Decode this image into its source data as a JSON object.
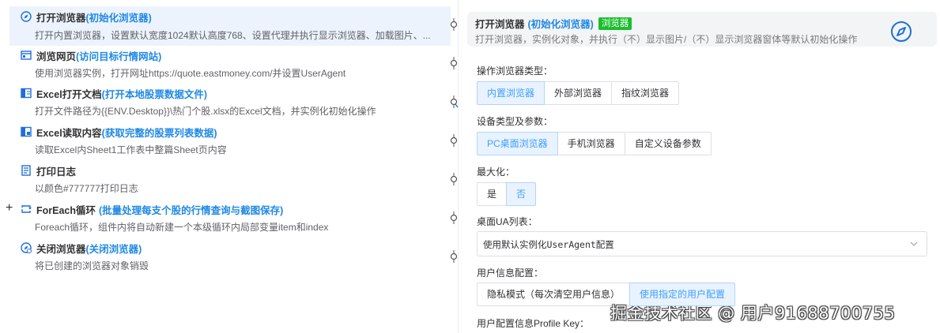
{
  "steps": [
    {
      "title": "打开浏览器",
      "note": "(初始化浏览器)",
      "desc": "打开内置浏览器，设置默认宽度1024默认高度768、设置代理并执行显示浏览器、加载图片、...",
      "icon": "compass-icon"
    },
    {
      "title": "浏览网页",
      "note": "(访问目标行情网站)",
      "desc": "使用浏览器实例，打开网址https://quote.eastmoney.com/并设置UserAgent",
      "icon": "browser-window-icon"
    },
    {
      "title": "Excel打开文档",
      "note": "(打开本地股票数据文件)",
      "desc": "打开文件路径为{{ENV.Desktop}}\\热门个股.xlsx的Excel文档，并实例化初始化操作",
      "icon": "excel-open-icon"
    },
    {
      "title": "Excel读取内容",
      "note": "(获取完整的股票列表数据)",
      "desc": "读取Excel内Sheet1工作表中整篇Sheet页内容",
      "icon": "excel-read-icon"
    },
    {
      "title": "打印日志",
      "note": "",
      "desc": "以颜色#777777打印日志",
      "icon": "log-icon"
    },
    {
      "title": "ForEach循环",
      "note": "(批量处理每支个股的行情查询与截图保存)",
      "desc": "Foreach循环，组件内将自动新建一个本级循环内局部变量item和index",
      "icon": "loop-icon"
    },
    {
      "title": "关闭浏览器",
      "note": "(关闭浏览器)",
      "desc": "将已创建的浏览器对象销毁",
      "icon": "compass-close-icon"
    }
  ],
  "panel": {
    "title": "打开浏览器",
    "note": "(初始化浏览器)",
    "badge": "浏览器",
    "desc": "打开浏览器，实例化对象，并执行（不）显示图片/（不）显示浏览器窗体等默认初始化操作",
    "browser_type_label": "操作浏览器类型：",
    "browser_types": [
      "内置浏览器",
      "外部浏览器",
      "指纹浏览器"
    ],
    "device_label": "设备类型及参数：",
    "devices": [
      "PC桌面浏览器",
      "手机浏览器",
      "自定义设备参数"
    ],
    "maximize_label": "最大化：",
    "maximize_options": [
      "是",
      "否"
    ],
    "ua_label": "桌面UA列表：",
    "ua_value": "使用默认实例化UserAgent配置",
    "user_info_label": "用户信息配置：",
    "user_info_options": [
      "隐私模式（每次清空用户信息）",
      "使用指定的用户配置"
    ],
    "profile_label": "用户配置信息Profile Key："
  },
  "watermark": "掘金技术社区 @ 用户91688700755",
  "colors": {
    "accent": "#1e88e5",
    "selected_bg": "#e8f3ff",
    "badge": "#19be2c",
    "active_row": "#ecf3fd"
  }
}
